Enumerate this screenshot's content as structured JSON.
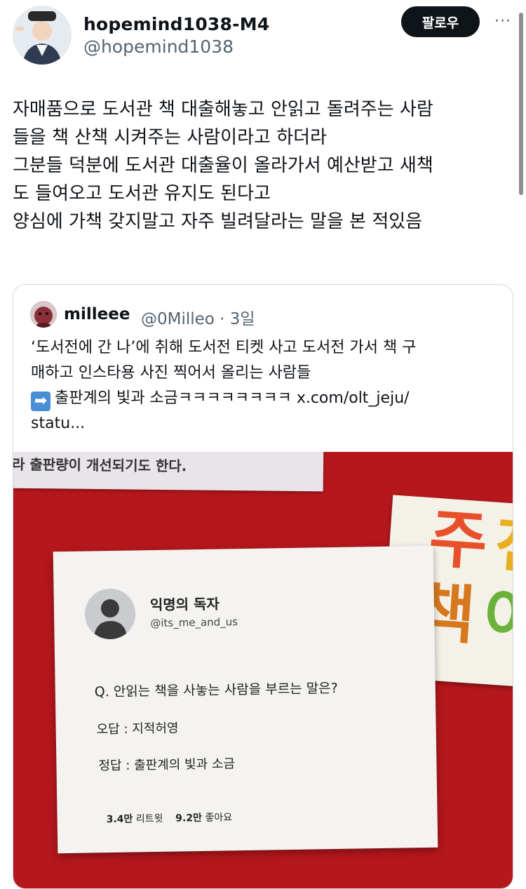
{
  "author": {
    "display_name": "hopemind1038-M4",
    "handle": "@hopemind1038",
    "avatar_icon": "user-avatar-icon"
  },
  "follow_button": "팔로우",
  "more_menu": "···",
  "tweet_text": "자매품으로 도서관 책 대출해놓고 안읽고 돌려주는 사람\n들을 책 산책 시켜주는 사람이라고 하더라\n그분들 덕분에 도서관 대출율이 올라가서 예산받고 새책\n도 들여오고 도서관 유지도 된다고\n양심에 가책 갖지말고 자주 빌려달라는 말을 본 적있음",
  "quote": {
    "display_name": "milleee",
    "handle_time": "@0Milleo · 3일",
    "text_line1": "‘도서전에 간 나’에 취해 도서전 티켓 사고 도서전 가서 책 구",
    "text_line2": "매하고 인스타용 사진 찍어서 올리는 사람들",
    "text_line3": "출판계의 빛과 소금ㅋㅋㅋㅋㅋㅋㅋㅋ x.com/olt_jeju/",
    "text_line4": "statu...",
    "arrow_emoji": "➡",
    "image": {
      "top_note": "라 출판량이 개선되기도 한다.",
      "rec_chars": [
        "주",
        "천",
        "책",
        "이"
      ],
      "paper": {
        "name": "익명의 독자",
        "handle": "@its_me_and_us",
        "question": "Q. 안읽는 책을 사놓는 사람을 부르는 말은?",
        "wrong": "오답 : 지적허영",
        "right": "정답 : 출판계의 빛과 소금",
        "retweets_value": "3.4만",
        "retweets_label": "리트윗",
        "likes_value": "9.2만",
        "likes_label": "좋아요"
      }
    }
  },
  "colors": {
    "follow_bg": "#0f1419",
    "secondary_text": "#536471",
    "board_red": "#b4171c"
  }
}
